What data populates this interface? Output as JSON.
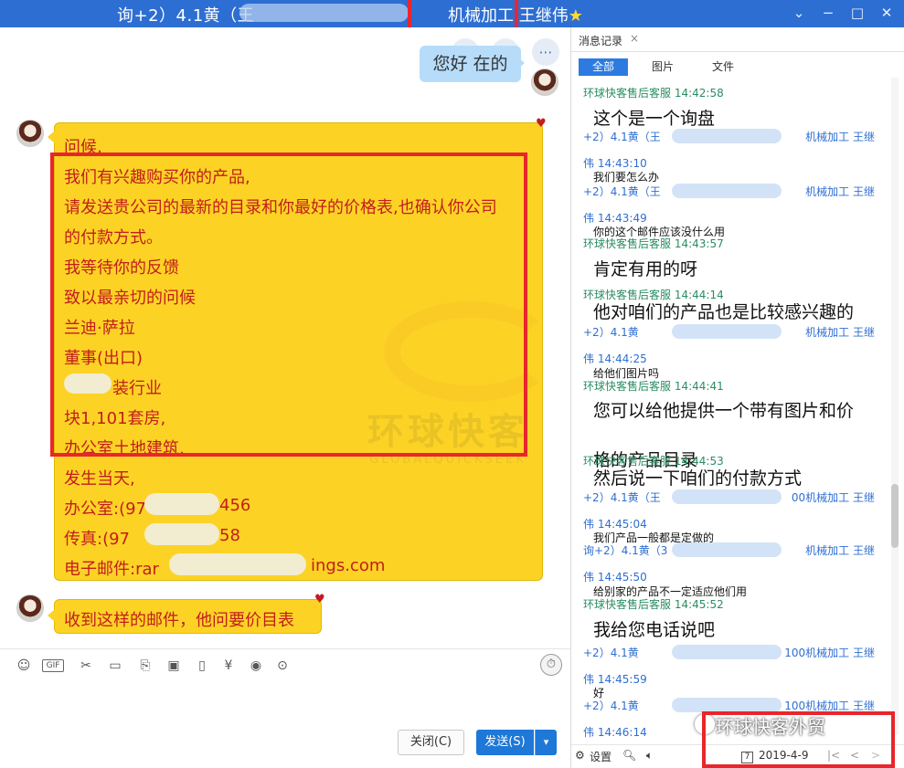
{
  "window": {
    "title_left": "询+2）4.1黄（王",
    "title_right": "机械加工 王继伟",
    "star": "★",
    "controls": [
      "⌄",
      "−",
      "□",
      "✕"
    ]
  },
  "chat": {
    "top_icons": [
      "phone-icon",
      "video-icon",
      "more-icon"
    ],
    "sent_message": "您好 在的",
    "email_lines": [
      "问候,",
      "我们有兴趣购买你的产品,",
      "请发送贵公司的最新的目录和你最好的价格表,也确认你公司",
      "的付款方式。",
      "我等待你的反馈",
      "致以最亲切的问候",
      "兰迪·萨拉",
      "董事(出口)",
      "装行业",
      "块1,101套房,",
      "办公室土地建筑,",
      "发生当天,",
      "办公室:(97",
      "传真:(97",
      "电子邮件:rar"
    ],
    "email_tails": {
      "office": "456",
      "fax": "58",
      "mail": "ings.com"
    },
    "second_message": "收到这样的邮件，他问要价目表",
    "watermark": "环球快客",
    "watermark_sub": "GLOBALQUICKSEEK"
  },
  "toolbar": {
    "icons": [
      "emoji-icon",
      "gif-icon",
      "scissors-icon",
      "folder-icon",
      "file-icon",
      "image-icon",
      "shake-icon",
      "red-packet-icon",
      "music-icon",
      "more-icon"
    ],
    "close_label": "关闭(C)",
    "send_label": "发送(S)",
    "send_arrow": "▾",
    "history_clock": "⏱"
  },
  "history": {
    "tab_label": "消息记录",
    "tab_close": "×",
    "filters": [
      "全部",
      "图片",
      "文件"
    ],
    "entries": [
      {
        "head": "环球快客售后客服 14:42:58",
        "head2": "",
        "color": "green",
        "msg": "这个是一个询盘",
        "size": "big"
      },
      {
        "head": "+2）4.1黄（王",
        "head_tail": "机械加工 王继",
        "head2": "伟 14:43:10",
        "color": "blue",
        "msg": "我们要怎么办",
        "size": "small"
      },
      {
        "head": "+2）4.1黄（王",
        "head_tail": "机械加工 王继",
        "head2": "伟 14:43:49",
        "color": "blue",
        "msg": "你的这个邮件应该没什么用",
        "size": "small"
      },
      {
        "head": "环球快客售后客服 14:43:57",
        "head2": "",
        "color": "green",
        "msg": "肯定有用的呀",
        "size": "big"
      },
      {
        "head": "环球快客售后客服 14:44:14",
        "head2": "",
        "color": "green",
        "msg": "他对咱们的产品也是比较感兴趣的",
        "size": "big"
      },
      {
        "head": "+2）4.1黄",
        "head_tail": "机械加工 王继",
        "head2": "伟 14:44:25",
        "color": "blue",
        "msg": "给他们图片吗",
        "size": "small"
      },
      {
        "head": "环球快客售后客服 14:44:41",
        "head2": "",
        "color": "green",
        "msg": "您可以给他提供一个带有图片和价",
        "msg2": "格的产品目录",
        "size": "big"
      },
      {
        "head": "环球快客售后客服 14:44:53",
        "head2": "",
        "color": "green",
        "msg": "然后说一下咱们的付款方式",
        "size": "big"
      },
      {
        "head": "+2）4.1黄（王",
        "head_tail": "00机械加工 王继",
        "head2": "伟 14:45:04",
        "color": "blue",
        "msg": "我们产品一般都是定做的",
        "size": "small"
      },
      {
        "head": "询+2）4.1黄（3",
        "head_tail": "机械加工 王继",
        "head2": "伟 14:45:50",
        "color": "blue",
        "msg": "给别家的产品不一定适应他们用",
        "size": "small"
      },
      {
        "head": "环球快客售后客服 14:45:52",
        "head2": "",
        "color": "green",
        "msg": "我给您电话说吧",
        "size": "big"
      },
      {
        "head": "+2）4.1黄",
        "head_tail": "100机械加工 王继",
        "head2": "伟 14:45:59",
        "color": "blue",
        "msg": "好",
        "size": "small"
      },
      {
        "head": "+2）4.1黄",
        "head_tail": "100机械加工 王继",
        "head2": "伟 14:46:14",
        "color": "blue",
        "msg": "",
        "size": "small"
      }
    ],
    "settings_label": "设置",
    "date": "2019-4-9",
    "nav": [
      "|<",
      "<",
      ">"
    ],
    "brand": "环球快客外贸"
  }
}
